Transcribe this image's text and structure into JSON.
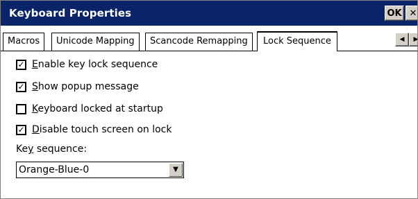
{
  "window": {
    "title": "Keyboard Properties",
    "ok_label": "OK",
    "close_label": "✕"
  },
  "tabs": [
    {
      "label": "Macros",
      "active": false
    },
    {
      "label": "Unicode Mapping",
      "active": false
    },
    {
      "label": "Scancode Remapping",
      "active": false
    },
    {
      "label": "Lock Sequence",
      "active": true
    }
  ],
  "tab_scroll": {
    "left": "◀",
    "right": "▶"
  },
  "options": {
    "enable_lock": {
      "underline": "E",
      "rest": "nable key lock sequence",
      "checked": true
    },
    "show_popup": {
      "underline": "S",
      "rest": "how popup message",
      "checked": true
    },
    "locked_startup": {
      "underline": "K",
      "rest": "eyboard locked at startup",
      "checked": false
    },
    "disable_touch": {
      "underline": "D",
      "rest": "isable touch screen on lock",
      "checked": true
    }
  },
  "key_sequence": {
    "label_pre": "Ke",
    "label_underline": "y",
    "label_post": " sequence:",
    "selected": "Orange-Blue-0",
    "dropdown_arrow": "▼"
  },
  "checkmark": "✓",
  "colors": {
    "titlebar": "#0a246a",
    "button_face": "#d4d0c8"
  }
}
